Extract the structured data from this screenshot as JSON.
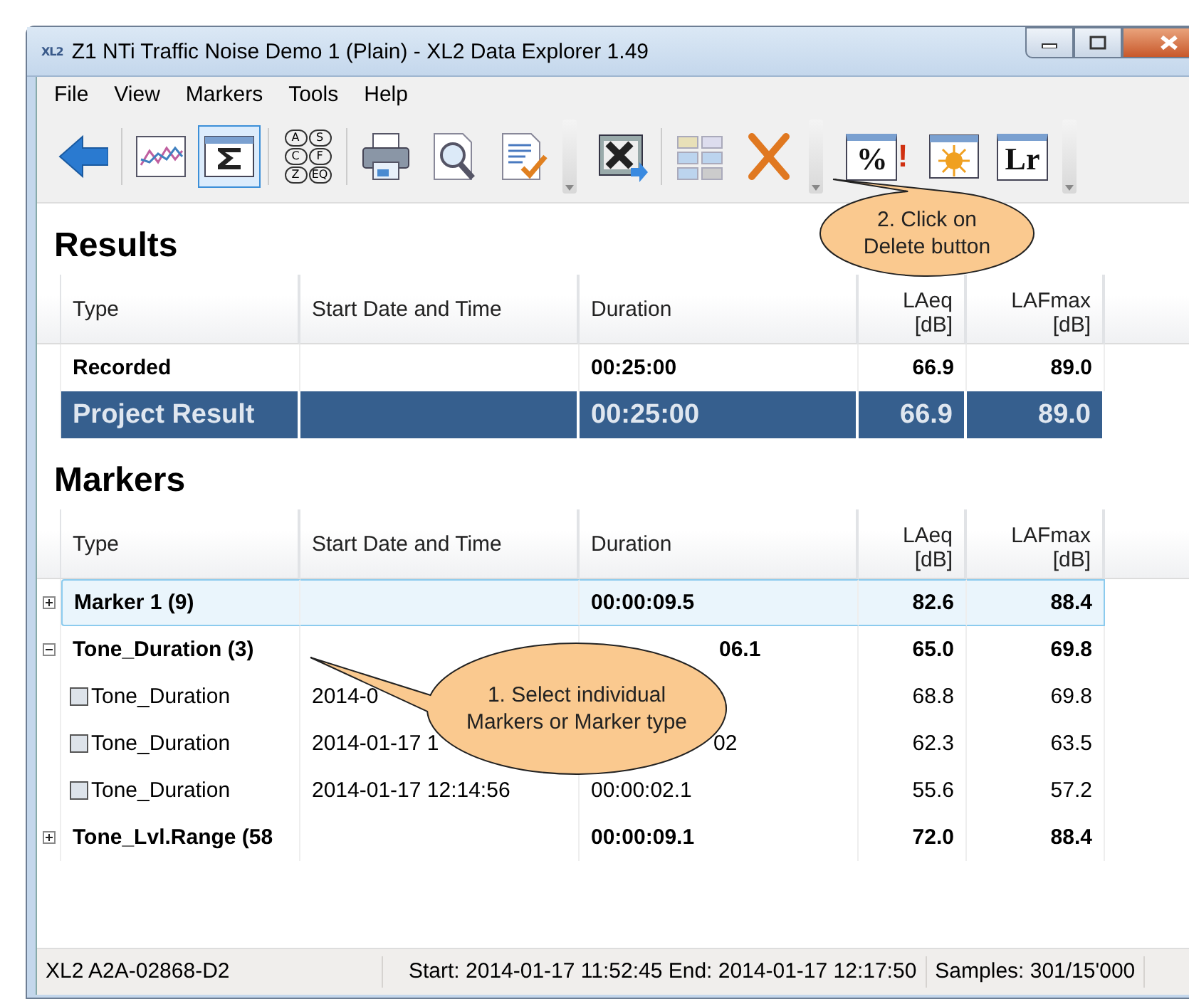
{
  "window": {
    "logo": "XL2",
    "title": "Z1 NTi Traffic Noise Demo 1 (Plain) - XL2 Data Explorer 1.49"
  },
  "menu": [
    "File",
    "View",
    "Markers",
    "Tools",
    "Help"
  ],
  "toolbar": [
    {
      "kind": "back",
      "selected": false
    },
    {
      "kind": "sep"
    },
    {
      "kind": "chart",
      "selected": false
    },
    {
      "kind": "sum",
      "selected": true
    },
    {
      "kind": "sep"
    },
    {
      "kind": "letters",
      "letters": [
        "A",
        "S",
        "C",
        "F",
        "Z",
        "EQ"
      ],
      "selected": false
    },
    {
      "kind": "sep"
    },
    {
      "kind": "print",
      "selected": false
    },
    {
      "kind": "preview",
      "selected": false
    },
    {
      "kind": "report",
      "selected": false
    },
    {
      "kind": "grip"
    },
    {
      "kind": "export",
      "selected": false
    },
    {
      "kind": "sep"
    },
    {
      "kind": "grid",
      "selected": false
    },
    {
      "kind": "delete",
      "selected": false
    },
    {
      "kind": "grip"
    },
    {
      "kind": "percent",
      "label": "%",
      "mark": "!",
      "selected": false
    },
    {
      "kind": "sun",
      "selected": false
    },
    {
      "kind": "lr",
      "label": "Lr",
      "selected": false
    },
    {
      "kind": "grip"
    }
  ],
  "results": {
    "heading": "Results",
    "columns": [
      "Type",
      "Start Date and Time",
      "Duration",
      "LAeq\n[dB]",
      "LAFmax\n[dB]"
    ],
    "rows": [
      {
        "type": "Recorded",
        "duration": "00:25:00",
        "laeq": "66.9",
        "lafmax": "89.0",
        "selected": false
      },
      {
        "type": "Project Result",
        "duration": "00:25:00",
        "laeq": "66.9",
        "lafmax": "89.0",
        "selected": true
      }
    ]
  },
  "markers": {
    "heading": "Markers",
    "columns": [
      "Type",
      "Start Date and Time",
      "Duration",
      "LAeq\n[dB]",
      "LAFmax\n[dB]"
    ],
    "rows": [
      {
        "type": "Marker 1 (9)",
        "duration": "00:00:09.5",
        "laeq": "82.6",
        "lafmax": "88.4",
        "expanded": false,
        "selected": true
      },
      {
        "type": "Tone_Duration (3)",
        "duration": "06.1",
        "duration_cut": true,
        "laeq": "65.0",
        "lafmax": "69.8",
        "expanded": true,
        "selected": false,
        "children": [
          {
            "type": "Tone_Duration",
            "start": "2014-0",
            "laeq": "68.8",
            "lafmax": "69.8",
            "selected": false
          },
          {
            "type": "Tone_Duration",
            "start": "2014-01-17 1",
            "duration": "02",
            "duration_cut": true,
            "laeq": "62.3",
            "lafmax": "63.5",
            "selected": false
          },
          {
            "type": "Tone_Duration",
            "start": "2014-01-17 12:14:56",
            "duration": "00:00:02.1",
            "laeq": "55.6",
            "lafmax": "57.2",
            "selected": false
          }
        ]
      },
      {
        "type": "Tone_Lvl.Range (58",
        "duration": "00:00:09.1",
        "laeq": "72.0",
        "lafmax": "88.4",
        "expanded": false,
        "selected": false
      }
    ]
  },
  "callouts": [
    {
      "kind": "delete",
      "text": "2. Click on Delete button"
    },
    {
      "kind": "select",
      "text": "1. Select individual Markers or Marker type"
    }
  ],
  "status_bar": [
    "XL2 A2A-02868-D2",
    "Start: 2014-01-17 11:52:45 End: 2014-01-17 12:17:50",
    "Samples: 301/15'000"
  ]
}
